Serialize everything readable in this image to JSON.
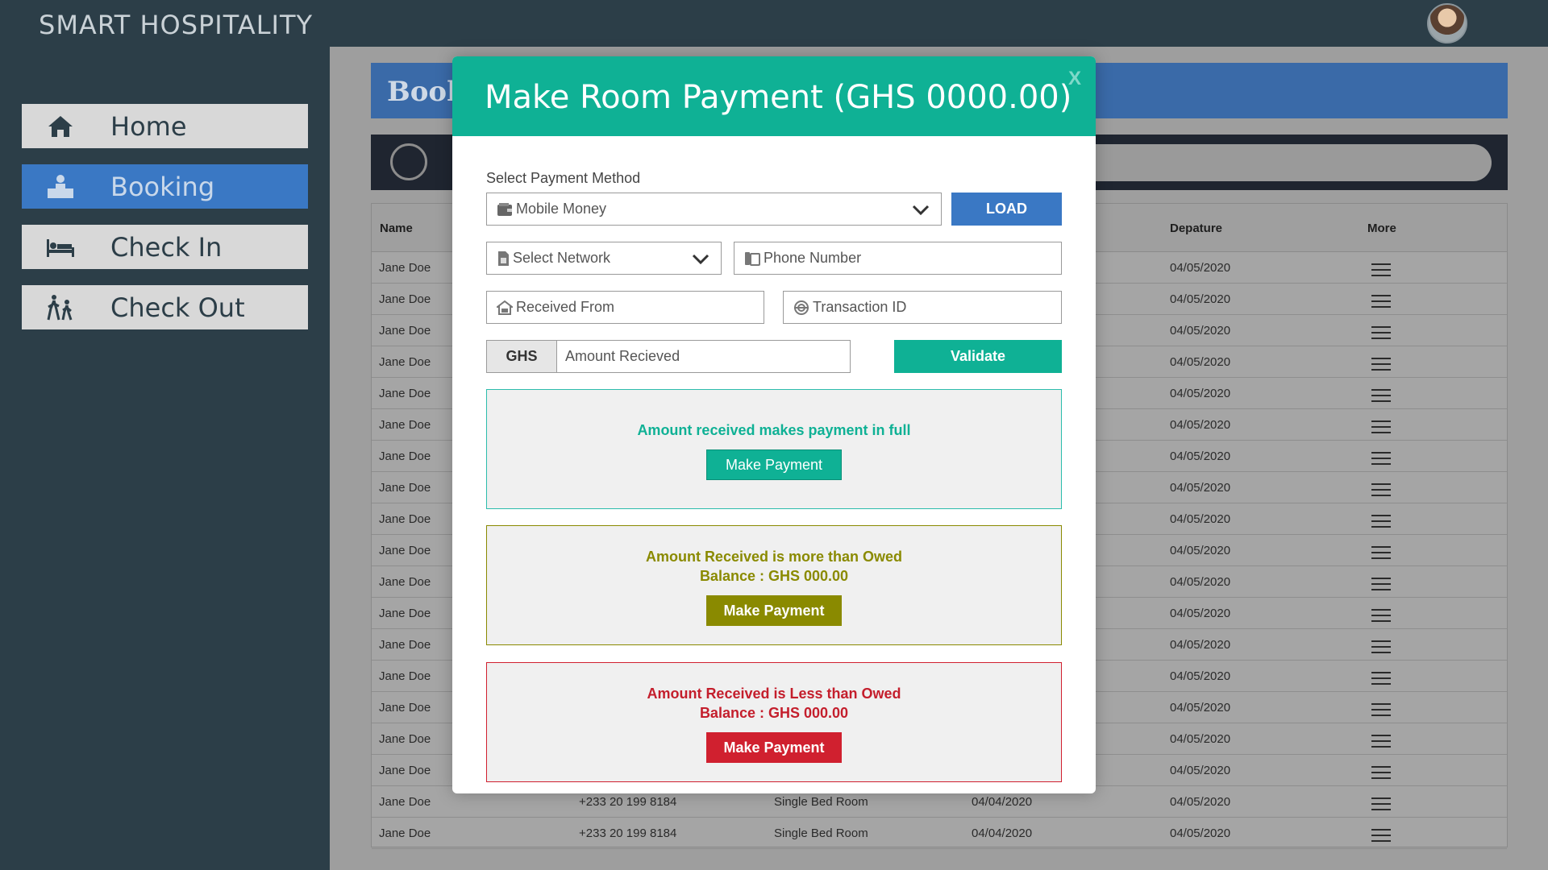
{
  "app": {
    "title": "SMART HOSPITALITY"
  },
  "sidebar": {
    "items": [
      {
        "label": "Home",
        "icon": "home-icon"
      },
      {
        "label": "Booking",
        "icon": "reception-desk-icon"
      },
      {
        "label": "Check In",
        "icon": "bed-icon"
      },
      {
        "label": "Check Out",
        "icon": "walking-people-icon"
      }
    ],
    "active": "Booking"
  },
  "page": {
    "banner_title": "Book"
  },
  "table": {
    "headers": {
      "name": "Name",
      "departure": "Depature",
      "more": "More"
    },
    "rows": [
      {
        "name": "Jane Doe",
        "departure": "04/05/2020"
      },
      {
        "name": "Jane Doe",
        "departure": "04/05/2020"
      },
      {
        "name": "Jane Doe",
        "departure": "04/05/2020"
      },
      {
        "name": "Jane Doe",
        "departure": "04/05/2020"
      },
      {
        "name": "Jane Doe",
        "departure": "04/05/2020"
      },
      {
        "name": "Jane Doe",
        "departure": "04/05/2020"
      },
      {
        "name": "Jane Doe",
        "departure": "04/05/2020"
      },
      {
        "name": "Jane Doe",
        "departure": "04/05/2020"
      },
      {
        "name": "Jane Doe",
        "departure": "04/05/2020"
      },
      {
        "name": "Jane Doe",
        "departure": "04/05/2020"
      },
      {
        "name": "Jane Doe",
        "departure": "04/05/2020"
      },
      {
        "name": "Jane Doe",
        "departure": "04/05/2020"
      },
      {
        "name": "Jane Doe",
        "departure": "04/05/2020"
      },
      {
        "name": "Jane Doe",
        "departure": "04/05/2020"
      },
      {
        "name": "Jane Doe",
        "departure": "04/05/2020"
      },
      {
        "name": "Jane Doe",
        "departure": "04/05/2020"
      },
      {
        "name": "Jane Doe",
        "departure": "04/05/2020"
      },
      {
        "name": "Jane Doe",
        "phone": "+233 20 199 8184",
        "room": "Single Bed Room",
        "arrival": "04/04/2020",
        "departure": "04/05/2020"
      },
      {
        "name": "Jane Doe",
        "phone": "+233 20 199 8184",
        "room": "Single Bed Room",
        "arrival": "04/04/2020",
        "departure": "04/05/2020"
      }
    ]
  },
  "modal": {
    "title": "Make Room Payment (GHS 0000.00)",
    "close_label": "X",
    "payment_method_label": "Select Payment Method",
    "payment_method_value": "Mobile Money",
    "load_label": "LOAD",
    "network_value": "Select Network",
    "phone_placeholder": "Phone Number",
    "received_from_placeholder": "Received From",
    "transaction_placeholder": "Transaction ID",
    "currency_prefix": "GHS",
    "amount_placeholder": "Amount Recieved",
    "validate_label": "Validate",
    "full": {
      "message": "Amount received makes payment in full",
      "button": "Make Payment"
    },
    "more": {
      "message": "Amount Received is more than Owed",
      "balance": "Balance : GHS 000.00",
      "button": "Make Payment"
    },
    "less": {
      "message": "Amount Received is Less than Owed",
      "balance": "Balance : GHS 000.00",
      "button": "Make Payment"
    }
  },
  "colors": {
    "teal": "#0fb195",
    "olive": "#8a8a00",
    "red": "#d0202f",
    "blue": "#3a78c4"
  }
}
